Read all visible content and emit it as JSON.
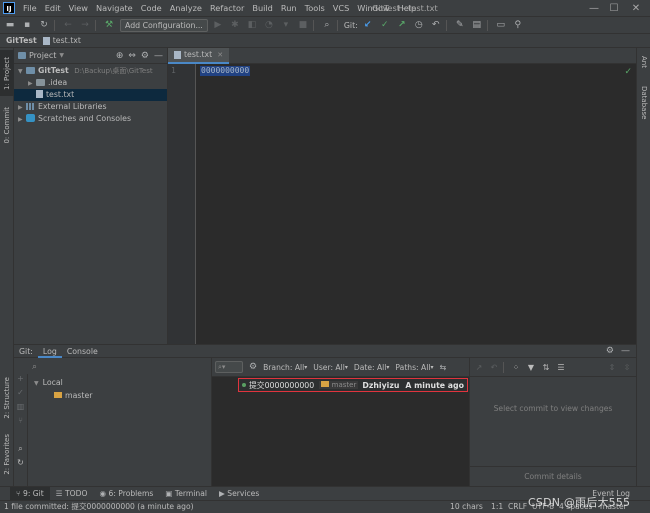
{
  "menu": {
    "items": [
      "File",
      "Edit",
      "View",
      "Navigate",
      "Code",
      "Analyze",
      "Refactor",
      "Build",
      "Run",
      "Tools",
      "VCS",
      "Window",
      "Help"
    ],
    "window_title": "GitTest - test.txt"
  },
  "toolbar": {
    "add_config_label": "Add Configuration...",
    "git_label": "Git:"
  },
  "breadcrumb": {
    "project": "GitTest",
    "file": "test.txt"
  },
  "left_stripe": {
    "project": "1: Project",
    "commit": "0: Commit",
    "structure": "2: Structure",
    "favorites": "2: Favorites"
  },
  "right_stripe": {
    "ant": "Ant",
    "database": "Database"
  },
  "project_panel": {
    "title": "Project",
    "root_name": "GitTest",
    "root_path": "D:\\Backup\\桌面\\GitTest",
    "idea": ".idea",
    "file": "test.txt",
    "external_libraries": "External Libraries",
    "scratches": "Scratches and Consoles"
  },
  "editor": {
    "tab_label": "test.txt",
    "line_number": "1",
    "content": "0000000000"
  },
  "git_window": {
    "title": "Git:",
    "tabs": [
      "Log",
      "Console"
    ],
    "branches": {
      "local": "Local",
      "master": "master"
    },
    "filters": [
      "Branch: All",
      "User: All",
      "Date: All",
      "Paths: All"
    ],
    "commit": {
      "message": "提交0000000000",
      "branch": "master",
      "author": "Dzhiyizu",
      "date": "A minute ago"
    },
    "details_hint": "Select commit to view changes",
    "commit_details": "Commit details"
  },
  "tool_tabs": [
    "9: Git",
    "TODO",
    "6: Problems",
    "Terminal",
    "Services"
  ],
  "event_log": "Event Log",
  "status": {
    "message": "1 file committed: 提交0000000000 (a minute ago)",
    "chars": "10 chars",
    "position": "1:1",
    "line_sep": "CRLF",
    "encoding": "UTF-8",
    "indent": "4 spaces",
    "branch": "master"
  },
  "watermark": "CSDN @雨后大555"
}
